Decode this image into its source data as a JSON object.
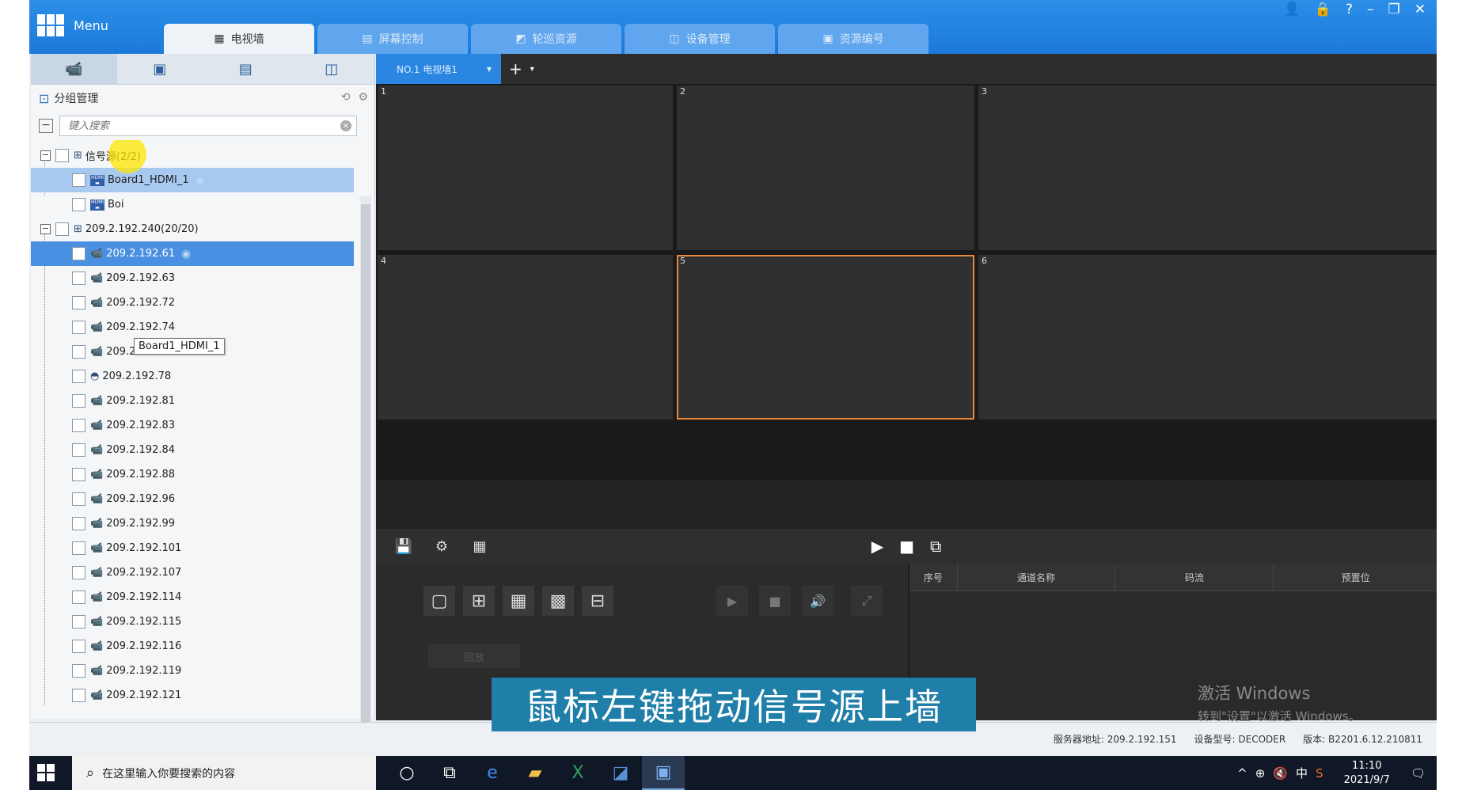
{
  "app": {
    "menu_label": "Menu",
    "tabs": [
      {
        "label": "电视墙",
        "icon": "tv-wall-icon",
        "active": true
      },
      {
        "label": "屏幕控制",
        "icon": "screen-control-icon"
      },
      {
        "label": "轮巡资源",
        "icon": "tour-resource-icon"
      },
      {
        "label": "设备管理",
        "icon": "device-manage-icon"
      },
      {
        "label": "资源编号",
        "icon": "resource-number-icon"
      }
    ]
  },
  "left_panel": {
    "group_title": "分组管理",
    "search_placeholder": "键入搜索",
    "root1": {
      "label": "信号源(2/2)"
    },
    "hdmi_items": [
      {
        "label": "Board1_HDMI_1"
      },
      {
        "label": "Boi"
      }
    ],
    "tooltip": "Board1_HDMI_1",
    "root2": {
      "label": "209.2.192.240(20/20)"
    },
    "cameras": [
      "209.2.192.61",
      "209.2.192.63",
      "209.2.192.72",
      "209.2.192.74",
      "209.2.192.77",
      "209.2.192.78",
      "209.2.192.81",
      "209.2.192.83",
      "209.2.192.84",
      "209.2.192.88",
      "209.2.192.96",
      "209.2.192.99",
      "209.2.192.101",
      "209.2.192.107",
      "209.2.192.114",
      "209.2.192.115",
      "209.2.192.116",
      "209.2.192.119",
      "209.2.192.121"
    ]
  },
  "wall": {
    "tab_label": "NO.1 电视墙1",
    "cells": [
      "1",
      "2",
      "3",
      "4",
      "5",
      "6"
    ],
    "selected_cell": "5"
  },
  "bottom": {
    "back_label": "回放",
    "columns": [
      "序号",
      "通道名称",
      "码流",
      "预置位"
    ]
  },
  "subtitle": "鼠标左键拖动信号源上墙",
  "watermark": {
    "line1": "激活 Windows",
    "line2": "转到\"设置\"以激活 Windows。"
  },
  "status": {
    "server": "服务器地址: 209.2.192.151",
    "device_type": "设备型号: DECODER",
    "version": "版本: B2201.6.12.210811"
  },
  "taskbar": {
    "search_placeholder": "在这里输入你要搜索的内容",
    "time": "11:10",
    "date": "2021/9/7",
    "ime": "中"
  }
}
